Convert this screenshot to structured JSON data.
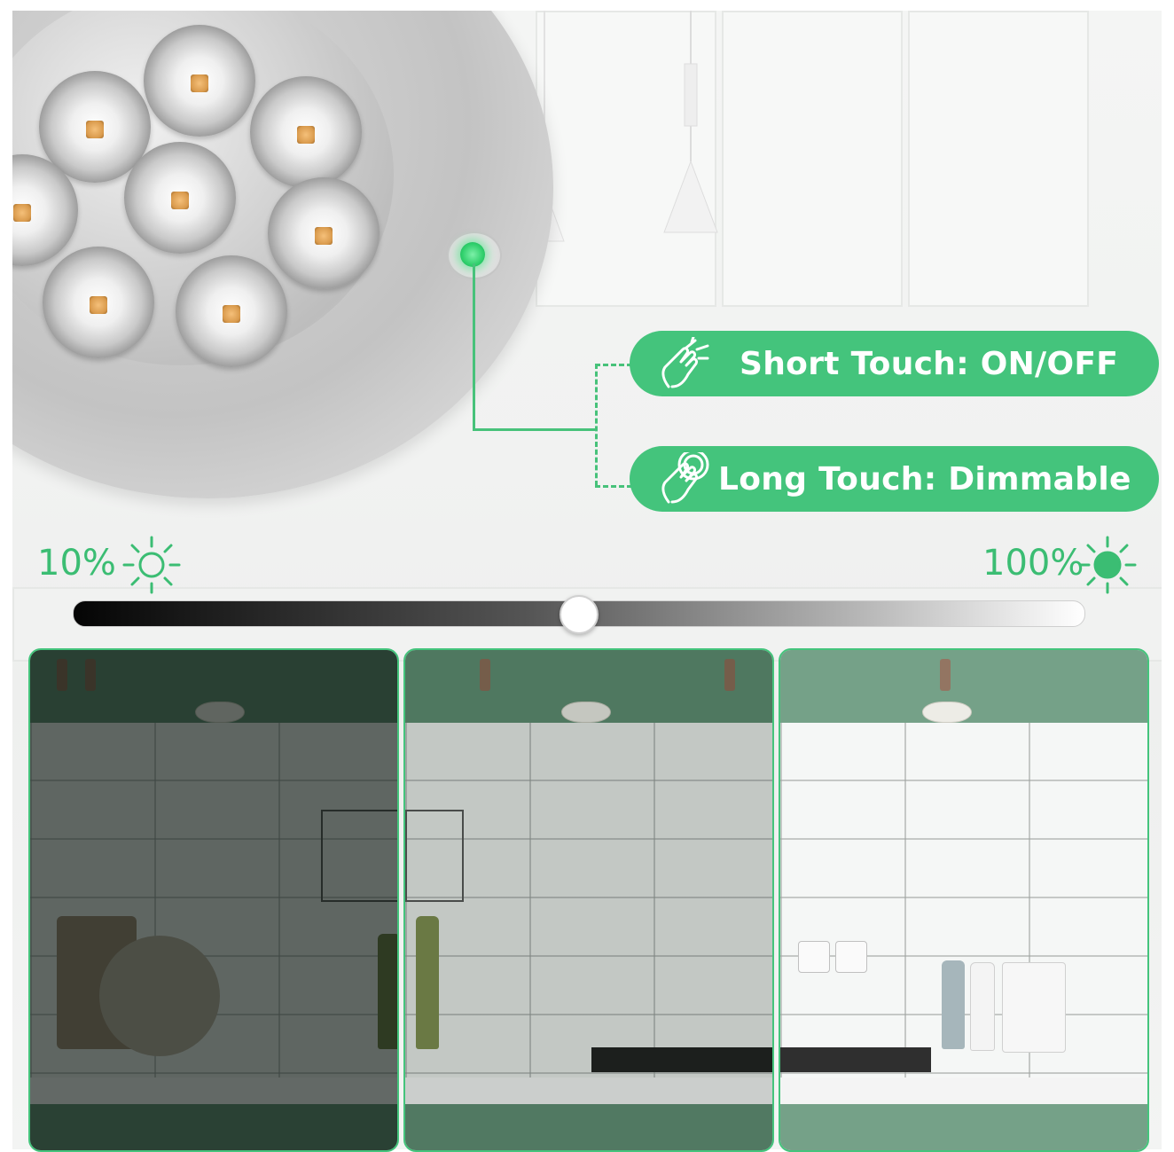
{
  "controls": {
    "short_touch": {
      "label": "Short Touch: ON/OFF",
      "icon": "tap-hand-icon"
    },
    "long_touch": {
      "label": "Long Touch: Dimmable",
      "icon": "press-hold-hand-icon"
    }
  },
  "brightness": {
    "min_label": "10%",
    "max_label": "100%",
    "slider_level": 0.5,
    "min_icon": "sun-outline-icon",
    "max_icon": "sun-filled-icon"
  },
  "colors": {
    "accent": "#44c47c",
    "accent_text": "#3bbd73",
    "touch_glow": "#2fcf6b"
  },
  "panels": [
    {
      "name": "dim-kitchen-panel",
      "brightness": "low"
    },
    {
      "name": "medium-kitchen-panel",
      "brightness": "medium"
    },
    {
      "name": "bright-kitchen-panel",
      "brightness": "high"
    }
  ]
}
